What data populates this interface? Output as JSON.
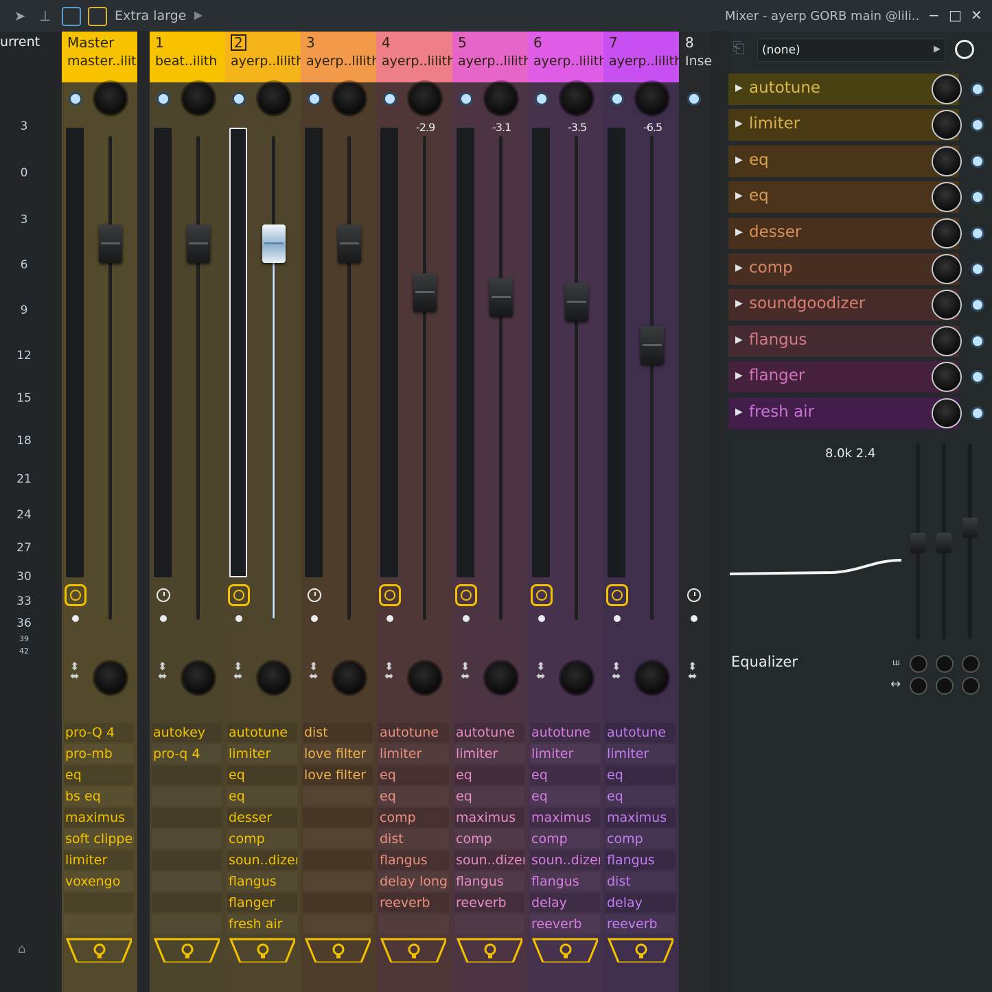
{
  "toolbar": {
    "size_label": "Extra large",
    "window_title": "Mixer - ayerp GORB main @lili..",
    "minimize": "−",
    "maximize": "□",
    "close": "✕"
  },
  "scale": {
    "current_label": "urrent",
    "ticks": [
      "3",
      "0",
      "3",
      "6",
      "9",
      "12",
      "15",
      "18",
      "21",
      "24",
      "27",
      "30",
      "33",
      "36",
      "39",
      "42"
    ]
  },
  "strips": [
    {
      "num": "Master",
      "name": "master..ilith",
      "value": "",
      "slots": [
        "pro-Q 4",
        "pro-mb",
        "eq",
        "bs eq",
        "maximus",
        "soft clipper",
        "limiter",
        "voxengo"
      ]
    },
    {
      "num": "1",
      "name": "beat..ilith",
      "value": "",
      "slots": [
        "autokey",
        "pro-q 4"
      ]
    },
    {
      "num": "2",
      "name": "ayerp..lilith",
      "value": "",
      "slots": [
        "autotune",
        "limiter",
        "eq",
        "eq",
        "desser",
        "comp",
        "soun..dizer",
        "flangus",
        "flanger",
        "fresh air"
      ]
    },
    {
      "num": "3",
      "name": "ayerp..lilith",
      "value": "",
      "slots": [
        "dist",
        "love filter",
        "love filter"
      ]
    },
    {
      "num": "4",
      "name": "ayerp..lilith",
      "value": "-2.9",
      "slots": [
        "autotune",
        "limiter",
        "eq",
        "eq",
        "comp",
        "dist",
        "flangus",
        "delay long",
        "reeverb"
      ]
    },
    {
      "num": "5",
      "name": "ayerp..lilith",
      "value": "-3.1",
      "slots": [
        "autotune",
        "limiter",
        "eq",
        "eq",
        "maximus",
        "comp",
        "soun..dizer",
        "flangus",
        "reeverb"
      ]
    },
    {
      "num": "6",
      "name": "ayerp..lilith",
      "value": "-3.5",
      "slots": [
        "autotune",
        "limiter",
        "eq",
        "eq",
        "maximus",
        "comp",
        "soun..dizer",
        "flangus",
        "delay",
        "reeverb"
      ]
    },
    {
      "num": "7",
      "name": "ayerp..lilith",
      "value": "-6.5",
      "slots": [
        "autotune",
        "limiter",
        "eq",
        "eq",
        "maximus",
        "comp",
        "flangus",
        "dist",
        "delay",
        "reeverb"
      ]
    }
  ],
  "insert8": {
    "num": "8",
    "name": "Inse"
  },
  "fx_panel": {
    "preset": "(none)",
    "slots": [
      "autotune",
      "limiter",
      "eq",
      "eq",
      "desser",
      "comp",
      "soundgoodizer",
      "flangus",
      "flanger",
      "fresh air"
    ],
    "eq_readout": "8.0k 2.4",
    "eq_title": "Equalizer"
  },
  "colors": {
    "header": [
      "#f7c300",
      "#f7c300",
      "#f5b51a",
      "#f29a4a",
      "#ee7f88",
      "#e765c9",
      "#df5de6",
      "#c84ff0"
    ],
    "strip_bg": [
      "#534a2b",
      "#4c452c",
      "#4e452c",
      "#4f3d2b",
      "#4e3736",
      "#4c3443",
      "#47324d",
      "#3f2f4d"
    ],
    "slot_text": [
      "#f2c200",
      "#f2c200",
      "#f2c200",
      "#f0b24a",
      "#ec8f7e",
      "#e88cc4",
      "#d77ee3",
      "#c37bf0"
    ],
    "accent": "#f2c200",
    "fx_rows": [
      "#4a4112",
      "#4a3a14",
      "#4a3518",
      "#4a3318",
      "#48301c",
      "#482d21",
      "#472b28",
      "#462a32",
      "#46213e",
      "#431e4a"
    ],
    "fx_text": [
      "#d7b84a",
      "#d7ae4a",
      "#d7a04f",
      "#d79a54",
      "#d7905a",
      "#d78563",
      "#d77c6e",
      "#d47a84",
      "#cf73b8",
      "#c973d8"
    ]
  },
  "faders": {
    "level": [
      0.78,
      0.78,
      0.78,
      0.78,
      0.68,
      0.67,
      0.66,
      0.57
    ]
  }
}
